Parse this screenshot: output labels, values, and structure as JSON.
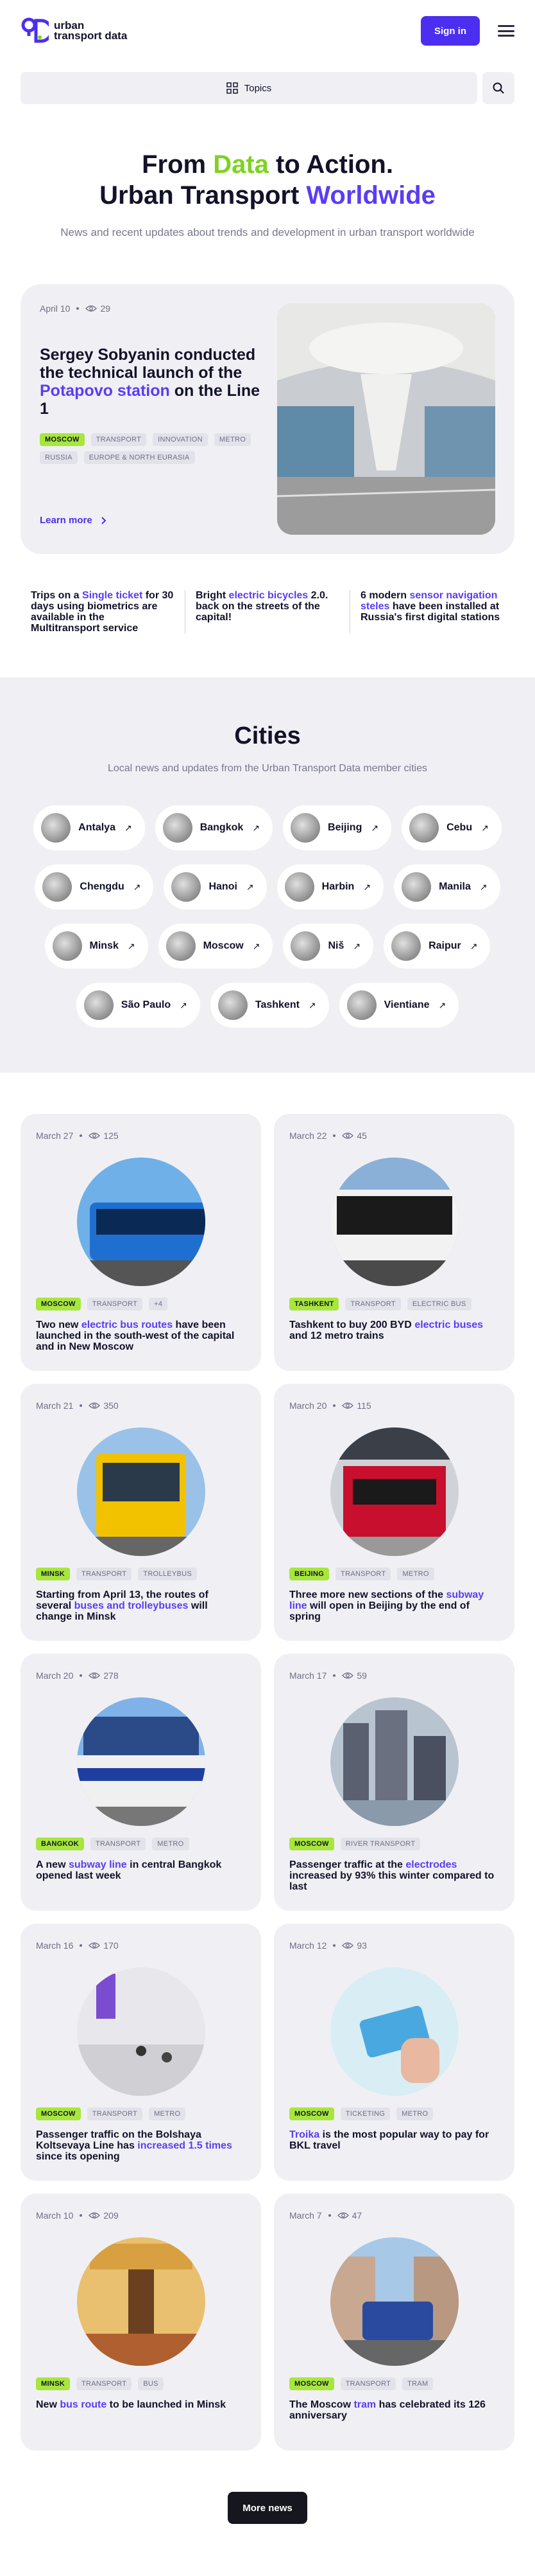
{
  "brand": {
    "name": "urban transport data",
    "logo_icon": "utd-logo-icon"
  },
  "header": {
    "signin_label": "Sign in",
    "menu_icon": "menu-icon"
  },
  "topics": {
    "label": "Topics",
    "icon": "grid-icon",
    "search_icon": "search-icon"
  },
  "hero": {
    "title_parts": [
      "From ",
      "Data",
      " to Action."
    ],
    "title2_parts": [
      "Urban Transport ",
      "Worldwide"
    ],
    "subtitle": "News and recent updates about trends and development in urban transport worldwide"
  },
  "featured": {
    "date": "April 10",
    "views": "29",
    "title_parts": [
      "Sergey Sobyanin conducted the technical launch of the ",
      "Potapovo station",
      " on the Line 1"
    ],
    "tags": [
      "MOSCOW",
      "TRANSPORT",
      "INNOVATION",
      "METRO",
      "RUSSIA",
      "EUROPE & NORTH EURASIA"
    ],
    "learn_more": "Learn more"
  },
  "highlights": [
    {
      "parts": [
        "Trips on a ",
        "Single ticket",
        " for 30 days using biometrics are available in the Multitransport service"
      ]
    },
    {
      "parts": [
        "Bright ",
        "electric bicycles",
        " 2.0. back on the streets of the capital!"
      ]
    },
    {
      "parts": [
        "6 modern ",
        "sensor navigation steles",
        " have been installed at Russia's first digital stations"
      ]
    }
  ],
  "cities": {
    "title": "Cities",
    "subtitle": "Local news and updates from the Urban Transport Data member cities",
    "rows": [
      [
        "Antalya",
        "Bangkok",
        "Beijing",
        "Cebu"
      ],
      [
        "Chengdu",
        "Hanoi",
        "Harbin",
        "Manila"
      ],
      [
        "Minsk",
        "Moscow",
        "Niš",
        "Raipur"
      ],
      [
        "São Paulo",
        "Tashkent",
        "Vientiane"
      ]
    ]
  },
  "news": [
    {
      "date": "March 27",
      "views": "125",
      "tags": [
        "MOSCOW",
        "TRANSPORT",
        "+4"
      ],
      "title_parts": [
        "Two new ",
        "electric bus routes",
        " have been launched in the south-west of the capital and in New Moscow"
      ],
      "img": "bus"
    },
    {
      "date": "March 22",
      "views": "45",
      "tags": [
        "TASHKENT",
        "TRANSPORT",
        "ELECTRIC BUS"
      ],
      "title_parts": [
        "Tashkent to buy 200 BYD ",
        "electric buses",
        " and 12 metro trains"
      ],
      "img": "ebus"
    },
    {
      "date": "March 21",
      "views": "350",
      "tags": [
        "MINSK",
        "TRANSPORT",
        "TROLLEYBUS"
      ],
      "title_parts": [
        "Starting from April 13, the routes of several ",
        "buses and trolleybuses",
        " will change in Minsk"
      ],
      "img": "ybus"
    },
    {
      "date": "March 20",
      "views": "115",
      "tags": [
        "BEIJING",
        "TRANSPORT",
        "METRO"
      ],
      "title_parts": [
        "Three more new sections of the ",
        "subway line",
        " will open in Beijing by the end of spring"
      ],
      "img": "metro"
    },
    {
      "date": "March 20",
      "views": "278",
      "tags": [
        "BANGKOK",
        "TRANSPORT",
        "METRO"
      ],
      "title_parts": [
        "A new ",
        "subway line",
        " in central Bangkok opened last week"
      ],
      "img": "train"
    },
    {
      "date": "March 17",
      "views": "59",
      "tags": [
        "MOSCOW",
        "RIVER TRANSPORT"
      ],
      "title_parts": [
        "Passenger traffic at the ",
        "electrodes",
        " increased by 93% this winter compared to last"
      ],
      "img": "city"
    },
    {
      "date": "March 16",
      "views": "170",
      "tags": [
        "MOSCOW",
        "TRANSPORT",
        "METRO"
      ],
      "title_parts": [
        "Passenger traffic on the Bolshaya Koltsevaya Line has ",
        "increased 1.5 times",
        " since its opening"
      ],
      "img": "station"
    },
    {
      "date": "March 12",
      "views": "93",
      "tags": [
        "MOSCOW",
        "TICKETING",
        "METRO"
      ],
      "title_parts": [
        "",
        "Troika",
        " is the most popular way to pay for BKL travel"
      ],
      "img": "card"
    },
    {
      "date": "March 10",
      "views": "209",
      "tags": [
        "MINSK",
        "TRANSPORT",
        "BUS"
      ],
      "title_parts": [
        "New ",
        "bus route",
        " to be launched in Minsk"
      ],
      "img": "interior"
    },
    {
      "date": "March 7",
      "views": "47",
      "tags": [
        "MOSCOW",
        "TRANSPORT",
        "TRAM"
      ],
      "title_parts": [
        "The Moscow ",
        "tram",
        " has celebrated its 126 anniversary"
      ],
      "img": "tram"
    }
  ],
  "more_label": "More news"
}
